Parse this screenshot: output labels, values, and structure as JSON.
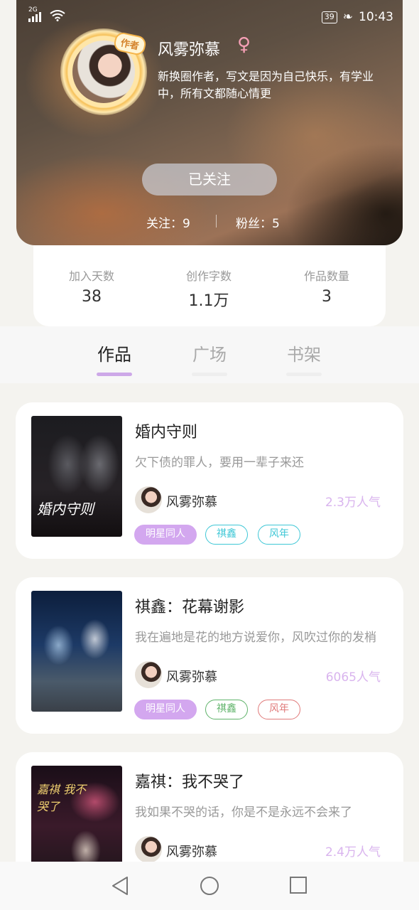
{
  "status_bar": {
    "signal": "2G",
    "battery": "39",
    "time": "10:43"
  },
  "profile": {
    "name": "风雾弥慕",
    "gender_symbol": "♀",
    "author_badge": "作者",
    "bio": "新换圈作者，写文是因为自己快乐，有学业中，所有文都随心情更",
    "follow_button": "已关注",
    "following_label": "关注：9",
    "fans_label": "粉丝：5"
  },
  "stats": [
    {
      "label": "加入天数",
      "value": "38"
    },
    {
      "label": "创作字数",
      "value": "1.1万"
    },
    {
      "label": "作品数量",
      "value": "3"
    }
  ],
  "tabs": [
    {
      "label": "作品",
      "active": true
    },
    {
      "label": "广场",
      "active": false
    },
    {
      "label": "书架",
      "active": false
    }
  ],
  "works": [
    {
      "title": "婚内守则",
      "desc": "欠下债的罪人，要用一辈子来还",
      "cover_text": "婚内守则",
      "author": "风雾弥慕",
      "popularity": "2.3万人气",
      "tags": [
        "明星同人",
        "祺鑫",
        "风年"
      ],
      "tag_colors": [
        "#ffffff",
        "#3ec7d6",
        "#3ec7d6"
      ]
    },
    {
      "title": "祺鑫：花幕谢影",
      "desc": "我在遍地是花的地方说爱你，风吹过你的发梢",
      "cover_text": "",
      "author": "风雾弥慕",
      "popularity": "6065人气",
      "tags": [
        "明星同人",
        "祺鑫",
        "风年"
      ],
      "tag_colors": [
        "#ffffff",
        "#5fb36a",
        "#e07a7a"
      ]
    },
    {
      "title": "嘉祺：我不哭了",
      "desc": "我如果不哭的话，你是不是永远不会来了",
      "cover_text": "嘉祺 我不哭了",
      "author": "风雾弥慕",
      "popularity": "2.4万人气",
      "tags": [],
      "tag_colors": []
    }
  ],
  "nav": {
    "back": "back-icon",
    "home": "home-icon",
    "recents": "recents-icon"
  }
}
